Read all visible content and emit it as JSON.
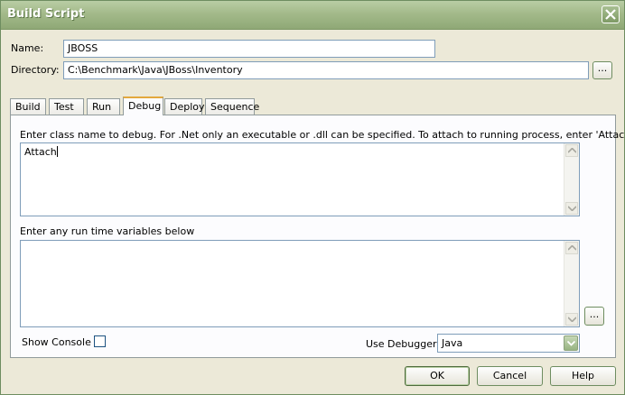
{
  "window": {
    "title": "Build Script"
  },
  "form": {
    "name_label": "Name:",
    "name_value": "JBOSS",
    "directory_label": "Directory:",
    "directory_value": "C:\\Benchmark\\Java\\JBoss\\Inventory",
    "browse_label": "..."
  },
  "tabs": [
    {
      "label": "Build"
    },
    {
      "label": "Test"
    },
    {
      "label": "Run"
    },
    {
      "label": "Debug",
      "active": true
    },
    {
      "label": "Deploy"
    },
    {
      "label": "Sequence"
    }
  ],
  "debug": {
    "class_prompt": "Enter class name to debug. For .Net only  an executable or .dll can be specified. To attach to running process, enter 'Attach'",
    "class_value": "Attach",
    "vars_prompt": "Enter any run time variables below",
    "vars_value": "",
    "vars_browse_label": "...",
    "show_console_label": "Show Console",
    "show_console_checked": false,
    "use_debugger_label": "Use Debugger:",
    "debugger_value": "Java"
  },
  "buttons": {
    "ok": "OK",
    "cancel": "Cancel",
    "help": "Help"
  },
  "icons": [
    "close-icon",
    "scroll-up-icon",
    "scroll-down-icon",
    "chevron-down-icon"
  ],
  "colors": {
    "titlebar": "#a3ba8a",
    "tab_accent": "#e3a83d",
    "dialog_bg": "#ece9d8"
  }
}
